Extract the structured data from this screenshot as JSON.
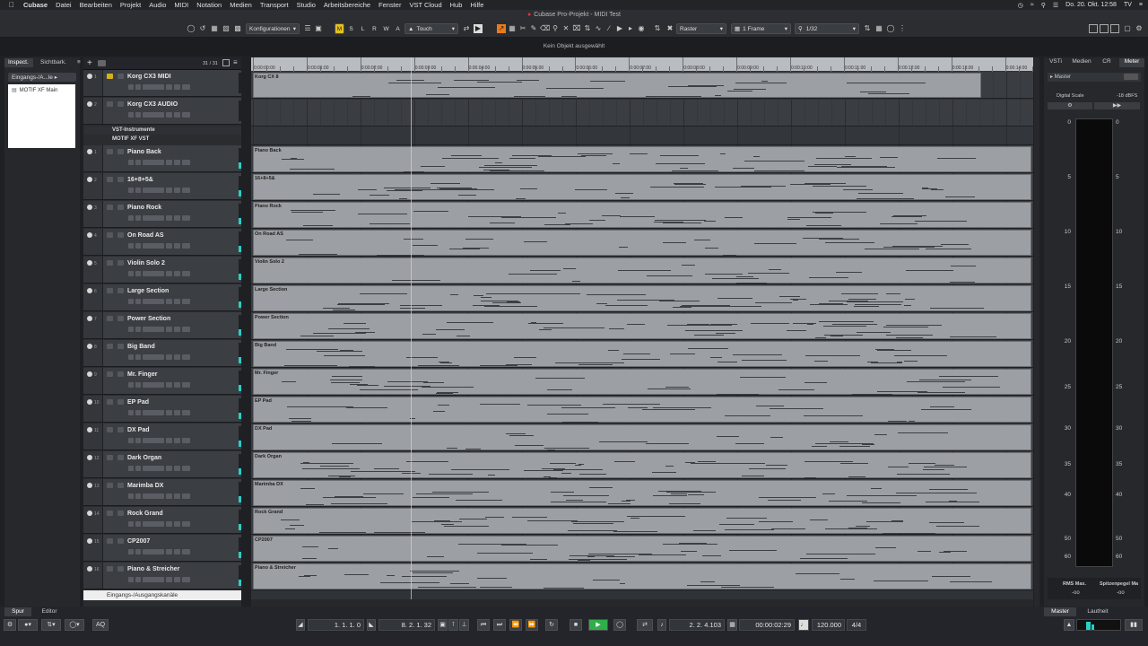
{
  "menubar": {
    "app": "Cubase",
    "items": [
      "Datei",
      "Bearbeiten",
      "Projekt",
      "Audio",
      "MIDI",
      "Notation",
      "Medien",
      "Transport",
      "Studio",
      "Arbeitsbereiche",
      "Fenster",
      "VST Cloud",
      "Hub",
      "Hilfe"
    ],
    "clock": "Do. 20. Okt. 12:58",
    "user": "TV"
  },
  "window": {
    "title": "Cubase Pro-Projekt - MIDI Test"
  },
  "toolbar": {
    "config": "Konfigurationen",
    "buttons": [
      "M",
      "S",
      "L",
      "R",
      "W",
      "A"
    ],
    "automation_mode": "Touch",
    "snap_type": "Raster",
    "grid": "1 Frame",
    "quantize": "1/32"
  },
  "status": {
    "message": "Kein Objekt ausgewählt"
  },
  "inspector": {
    "tabs": [
      "Inspect.",
      "Sichtbark."
    ],
    "routing": "Eingangs-/A...le",
    "instrument": "MOTIF XF Main"
  },
  "tracklist": {
    "counter": "31 / 31",
    "tracks": [
      {
        "name": "Korg CX3  MIDI",
        "num": "1"
      },
      {
        "name": "Korg CX3  AUDIO",
        "num": "2"
      },
      {
        "name": "Piano Back",
        "num": "1"
      },
      {
        "name": "16+8+5&",
        "num": "2"
      },
      {
        "name": "Piano Rock",
        "num": "3"
      },
      {
        "name": "On Road AS",
        "num": "4"
      },
      {
        "name": "Violin Solo 2",
        "num": "5"
      },
      {
        "name": "Large Section",
        "num": "6"
      },
      {
        "name": "Power Section",
        "num": "7"
      },
      {
        "name": "Big Band",
        "num": "8"
      },
      {
        "name": "Mr. Finger",
        "num": "9"
      },
      {
        "name": "EP Pad",
        "num": "10"
      },
      {
        "name": "DX Pad",
        "num": "11"
      },
      {
        "name": "Dark Organ",
        "num": "12"
      },
      {
        "name": "Marimba DX",
        "num": "13"
      },
      {
        "name": "Rock Grand",
        "num": "14"
      },
      {
        "name": "CP2007",
        "num": "15"
      },
      {
        "name": "Piano & Streicher",
        "num": "16"
      }
    ],
    "group_vst": "VST-Instrumente",
    "group_motif": "MOTIF XF VST",
    "footer": "Eingangs-/Ausgangskanäle"
  },
  "ruler": {
    "labels": [
      "0:00:00:00",
      "0:00:01:00",
      "0:00:02:00",
      "0:00:03:00",
      "0:00:04:00",
      "0:00:05:00",
      "0:00:06:00",
      "0:00:07:00",
      "0:00:08:00",
      "0:00:09:00",
      "0:00:10:00",
      "0:00:11:00",
      "0:00:12:00",
      "0:00:13:00",
      "0:00:14:00"
    ]
  },
  "parts": [
    "Korg CX 8",
    "Piano Back",
    "16+8+5&",
    "Piano Rock",
    "On Road AS",
    "Violin Solo 2",
    "Large Section",
    "Power Section",
    "Big Band",
    "Mr. Finger",
    "EP Pad",
    "DX Pad",
    "Dark Organ",
    "Marimba DX",
    "Rock Grand",
    "CP2007",
    "Piano & Streicher"
  ],
  "right_panel": {
    "tabs": [
      "VSTi",
      "Medien",
      "CR",
      "Meter"
    ],
    "master": "Master",
    "digital_scale": "Digital Scale",
    "dbfs": "-18 dBFS",
    "scale": [
      "0",
      "5",
      "10",
      "15",
      "20",
      "25",
      "30",
      "35",
      "40",
      "50",
      "60"
    ],
    "rms_label": "RMS Max.",
    "peak_label": "Spitzenpegel Ma",
    "rms_value": "-oo",
    "peak_value": "-oo",
    "bottom_tabs": [
      "Master",
      "Lautheit"
    ]
  },
  "bottom": {
    "left_tabs": [
      "Spur",
      "Editor"
    ],
    "aq": "AQ"
  },
  "transport": {
    "left_locator": "1. 1. 1.   0",
    "right_locator": "8. 2. 1. 32",
    "position_bars": "2. 2. 4.103",
    "position_time": "00:00:02:29",
    "tempo": "120.000",
    "signature": "4/4"
  }
}
